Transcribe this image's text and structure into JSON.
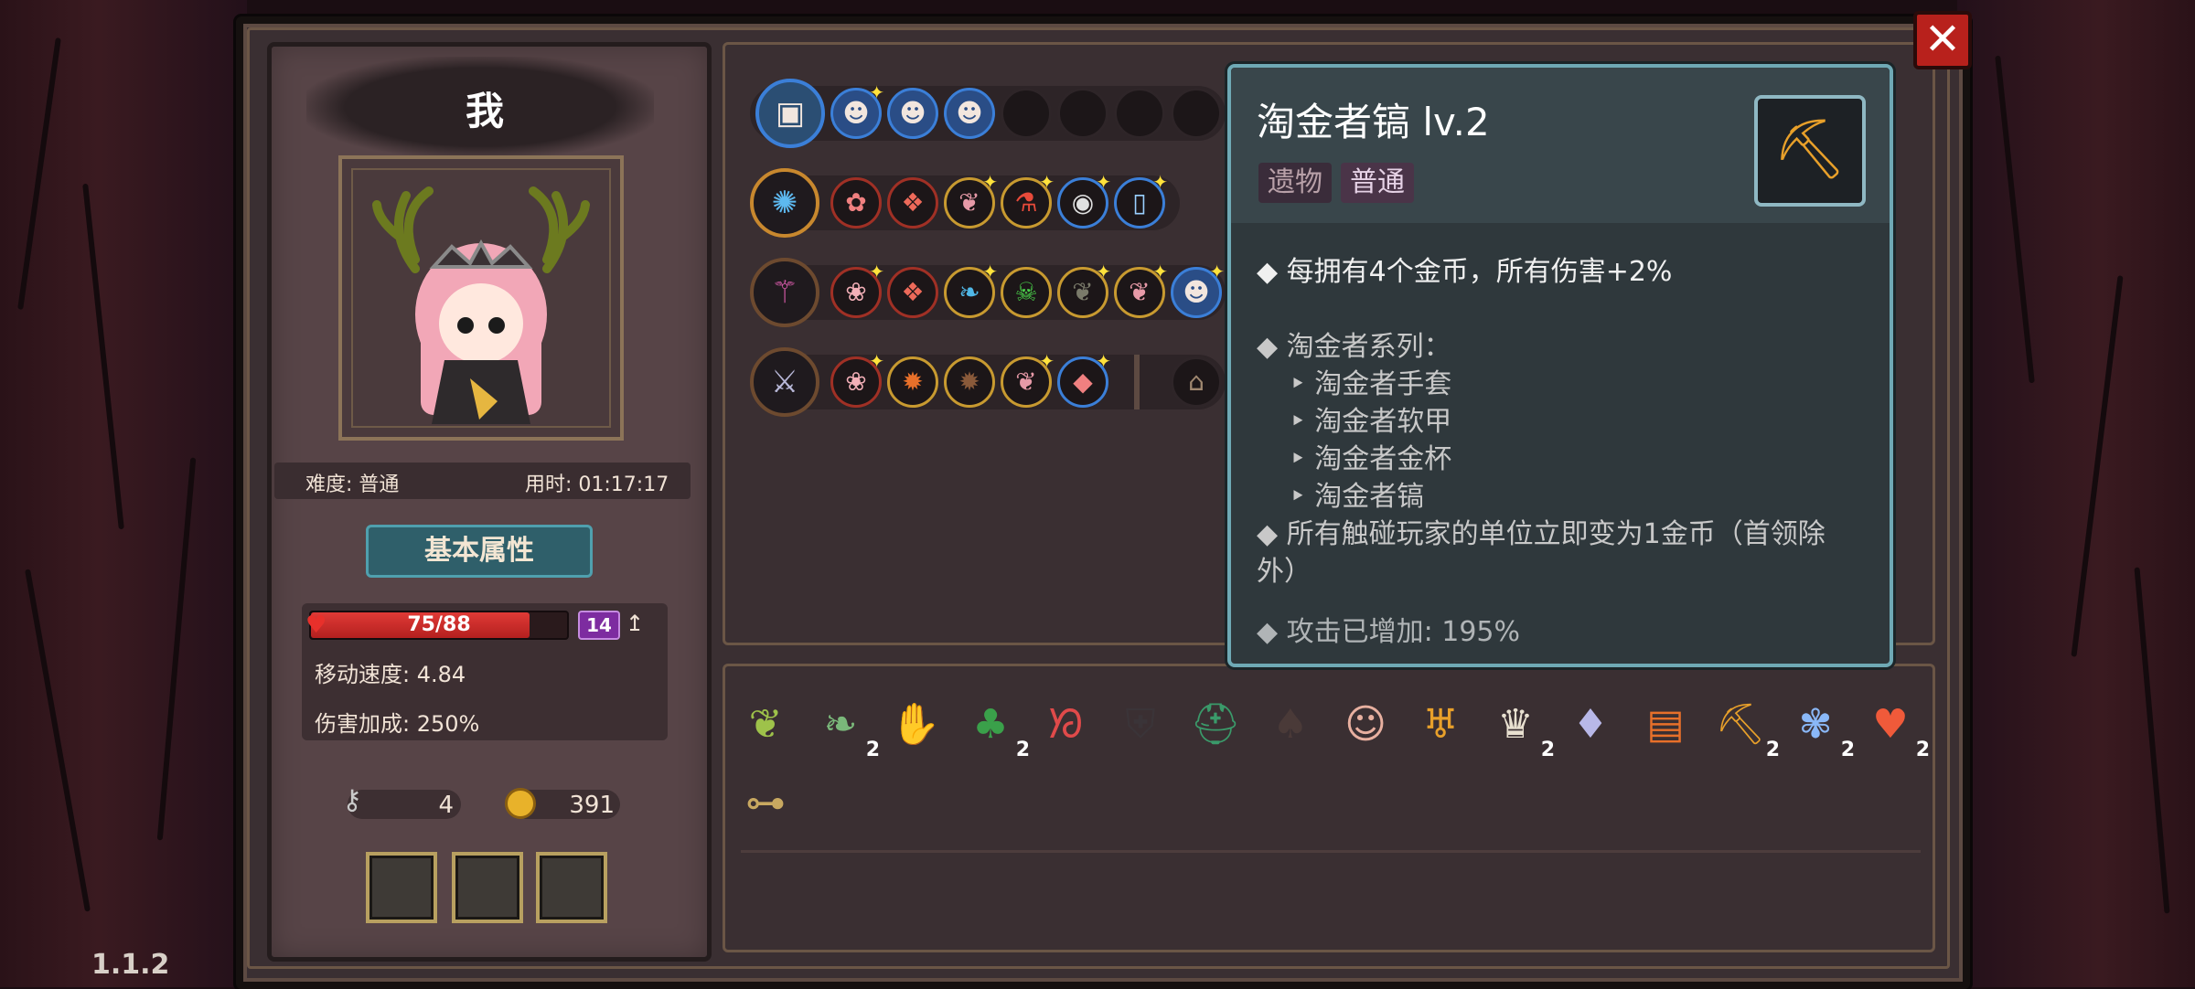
{
  "version": "1.1.2",
  "character": {
    "name": "我",
    "difficulty": "难度: 普通",
    "time": "用时: 01:17:17",
    "tab_label": "基本属性",
    "hp_text": "75/88",
    "hp_fraction": 0.852,
    "level": "14",
    "move_speed": "移动速度: 4.84",
    "damage_bonus": "伤害加成: 250%",
    "keys": "4",
    "coins": "391"
  },
  "tooltip": {
    "title": "淘金者镐 lv.2",
    "tags": [
      "遗物",
      "普通"
    ],
    "icon": "pickaxe-icon",
    "line1": "每拥有4个金币，所有伤害+2%",
    "series_title": "淘金者系列：",
    "series": [
      "淘金者手套",
      "淘金者软甲",
      "淘金者金杯",
      "淘金者镐"
    ],
    "line3a": "所有触碰玩家的单位立即变为1金币（首领除",
    "line3b": "外）",
    "attack_bonus": "攻击已增加: 195%"
  },
  "inventory_counts": [
    "2",
    "2",
    "2",
    "2",
    "2",
    "2"
  ],
  "colors": {
    "accent": "#6fa9b5",
    "hp": "#e03a36",
    "level": "#7d2ca0",
    "tag_relic": "#b8a0a8",
    "tag_common": "#e6d2e6"
  }
}
